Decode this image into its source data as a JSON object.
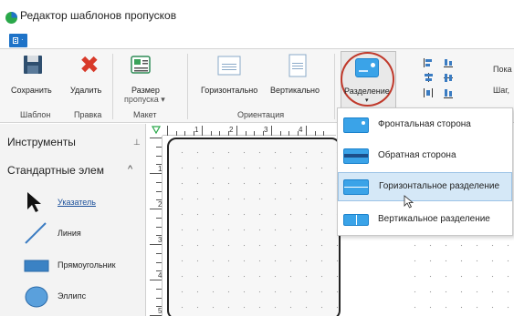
{
  "window": {
    "title": "Редактор шаблонов пропусков"
  },
  "menu": {
    "file_glyph": "file-menu-icon"
  },
  "ribbon": {
    "save": "Сохранить",
    "delete": "Удалить",
    "size_line1": "Размер",
    "size_line2": "пропуска ▾",
    "horizontal": "Горизонтально",
    "vertical": "Вертикально",
    "split": "Разделение",
    "split_arrow": "▾",
    "show": "Пока",
    "step": "Шаг,",
    "groups": {
      "template": "Шаблон",
      "edit": "Правка",
      "layout": "Макет",
      "orientation": "Ориентация"
    }
  },
  "tools": {
    "title": "Инструменты",
    "pin": "⊥",
    "section": "Стандартные элем",
    "chevron": "^",
    "items": [
      {
        "label": "Указатель",
        "icon": "pointer-icon"
      },
      {
        "label": "Линия",
        "icon": "line-icon"
      },
      {
        "label": "Прямоугольник",
        "icon": "rectangle-icon"
      },
      {
        "label": "Эллипс",
        "icon": "ellipse-icon"
      }
    ]
  },
  "ruler": {
    "top": [
      "1",
      "2",
      "3",
      "4"
    ],
    "left": [
      "1",
      "2",
      "3",
      "4",
      "5"
    ]
  },
  "split_menu": {
    "items": [
      {
        "label": "Фронтальная сторона"
      },
      {
        "label": "Обратная сторона"
      },
      {
        "label": "Горизонтальное разделение"
      },
      {
        "label": "Вертикальное разделение"
      }
    ]
  },
  "colors": {
    "accent": "#1e73c8",
    "highlight_ring": "#c0392b",
    "hover": "#d5e8f7"
  }
}
